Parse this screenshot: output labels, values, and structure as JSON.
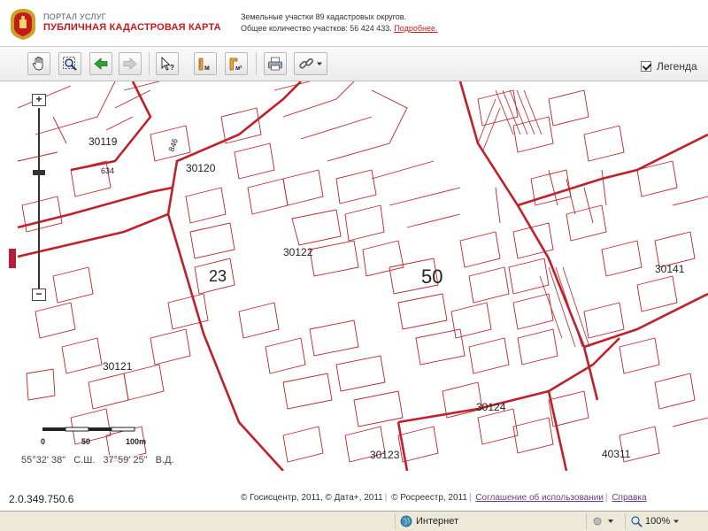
{
  "header": {
    "portal": "ПОРТАЛ УСЛУГ",
    "map_name": "ПУБЛИЧНАЯ КАДАСТРОВАЯ КАРТА",
    "info_line1": "Земельные участки 89 кадастровых округов.",
    "info_line2": "Общее количество участков: 56 424 433.",
    "more_link": "Подробнее."
  },
  "toolbar": {
    "buttons": [
      "pan-hand-icon",
      "zoom-box-icon",
      "back-arrow-icon",
      "forward-arrow-icon",
      "identify-icon",
      "measure-length-icon",
      "measure-area-icon",
      "print-icon",
      "link-icon"
    ],
    "legend_label": "Легенда",
    "legend_checked": true
  },
  "map": {
    "accent": "#c41a1a",
    "parcel_color": "#c0202a",
    "labels": {
      "district_30119": "30119",
      "district_30120": "30120",
      "district_30122": "30122",
      "district_30121": "30121",
      "district_30124": "30124",
      "district_30123": "30123",
      "district_30141": "30141",
      "district_40311": "40311",
      "quarter_23": "23",
      "quarter_50": "50",
      "p634": "634",
      "p846": "846"
    },
    "scale": {
      "zero": "0",
      "mid": "50",
      "end": "100m"
    },
    "coords": {
      "lat": "55°32' 38\"",
      "lat_dir": "С.Ш.",
      "lon": "37°59' 25\"",
      "lon_dir": "В.Д."
    }
  },
  "footer": {
    "version": "2.0.349.750.6",
    "copyright1": "© Госисцентр, 2011,",
    "copyright2": "© Дата+, 2011",
    "copyright3": "© Росреестр, 2011",
    "agreement_link": "Соглашение об использовании",
    "help_link": "Справка"
  },
  "statusbar": {
    "zone": "Интернет",
    "zoom": "100%"
  }
}
